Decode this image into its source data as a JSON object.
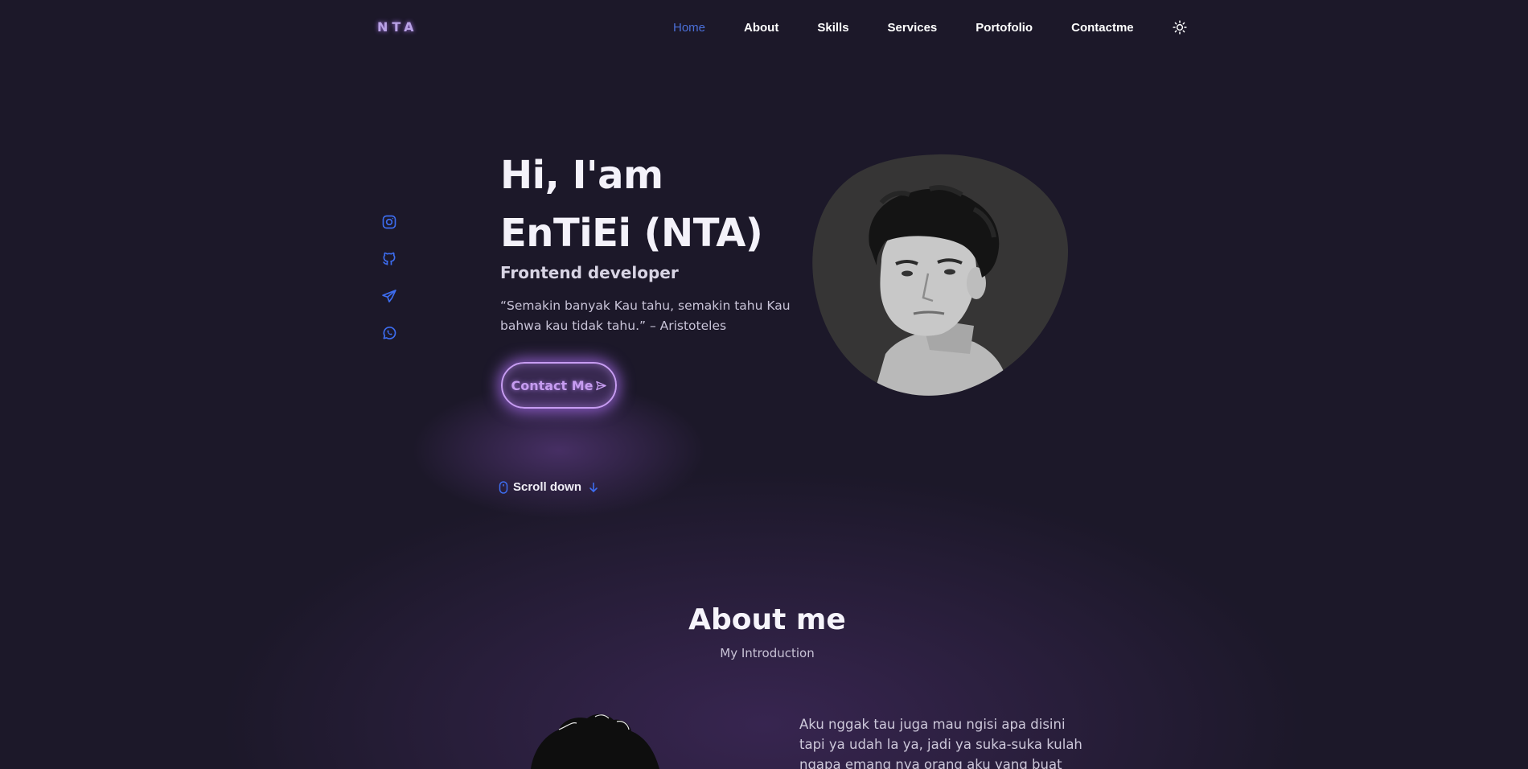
{
  "brand": {
    "logo": "NTA"
  },
  "nav": {
    "items": [
      {
        "label": "Home",
        "active": true
      },
      {
        "label": "About"
      },
      {
        "label": "Skills"
      },
      {
        "label": "Services"
      },
      {
        "label": "Portofolio"
      },
      {
        "label": "Contactme"
      }
    ],
    "theme_toggle_icon": "sun-icon"
  },
  "social": [
    {
      "icon": "instagram-icon"
    },
    {
      "icon": "github-icon"
    },
    {
      "icon": "telegram-icon"
    },
    {
      "icon": "whatsapp-icon"
    }
  ],
  "hero": {
    "title": "Hi, I'am EnTiEi (NTA)",
    "role": "Frontend developer",
    "quote": "“Semakin banyak Kau tahu, semakin tahu Kau bahwa kau tidak tahu.” – Aristoteles",
    "cta_label": "Contact Me",
    "scroll_label": "Scroll down"
  },
  "about": {
    "title": "About me",
    "subtitle": "My Introduction",
    "text": "Aku nggak tau juga mau ngisi apa disini tapi ya udah la ya, jadi ya suka-suka kulah ngapa emang nya orang aku yang buat"
  },
  "colors": {
    "background": "#1c1829",
    "accent": "#4b6fd8",
    "glow": "#c79cf2",
    "blob": "#363535"
  }
}
